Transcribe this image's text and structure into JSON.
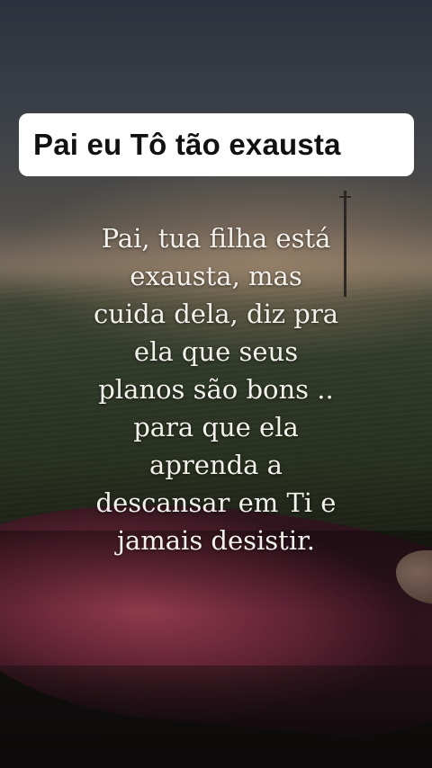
{
  "title": "Pai eu Tô tão exausta",
  "message": {
    "lines": [
      "Pai, tua filha está",
      "exausta, mas",
      "cuida dela, diz pra",
      "ela que seus",
      "planos são bons ..",
      "para que ela",
      "aprenda a",
      "descansar em Ti e",
      "jamais desistir."
    ]
  },
  "colors": {
    "banner_background": "#ffffff",
    "banner_text": "#111111",
    "message_text": "#f3f1ec"
  }
}
